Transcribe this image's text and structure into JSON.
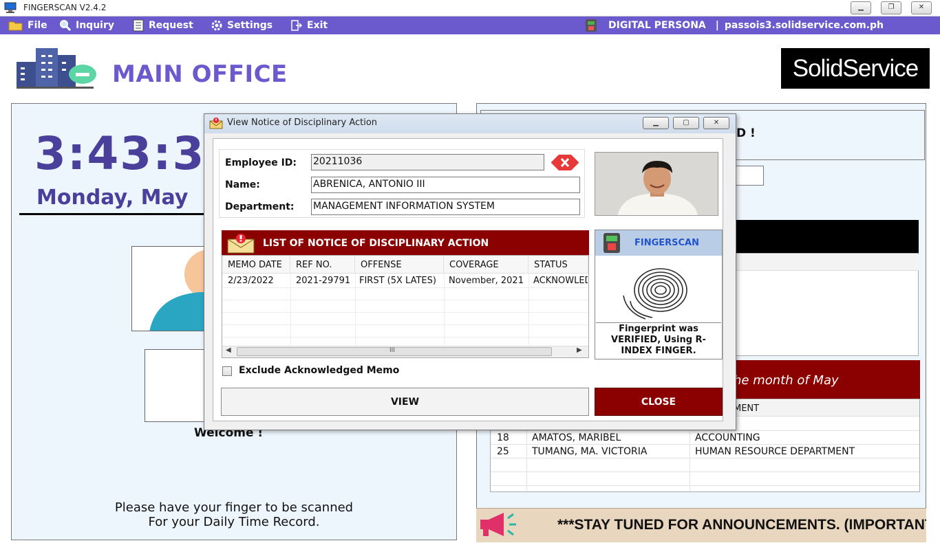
{
  "window": {
    "title": "FINGERSCAN V2.4.2"
  },
  "menu": {
    "file": "File",
    "inquiry": "Inquiry",
    "request": "Request",
    "settings": "Settings",
    "exit": "Exit",
    "device": "DIGITAL PERSONA",
    "server": "passois3.solidservice.com.ph",
    "separator": "|"
  },
  "header": {
    "office": "MAIN OFFICE",
    "logo": "SolidService"
  },
  "left": {
    "clock": "3:43:3",
    "date": "Monday, May",
    "welcome": "Welcome !",
    "instruction_1": "Please have your finger to be scanned",
    "instruction_2": "For your Daily Time Record."
  },
  "right": {
    "top_text": "D !",
    "birthday_title": "he month of May",
    "birthday_dept_header": "MENT",
    "birthdays": [
      {
        "day": "18",
        "name": "AMATOS, MARIBEL",
        "dept": "ACCOUNTING"
      },
      {
        "day": "25",
        "name": "TUMANG, MA. VICTORIA",
        "dept": "HUMAN RESOURCE DEPARTMENT"
      }
    ],
    "announcement": "***STAY TUNED FOR ANNOUNCEMENTS. (IMPORTANT"
  },
  "dialog": {
    "title": "View Notice of Disciplinary Action",
    "employee_id_label": "Employee ID:",
    "employee_id": "20211036",
    "name_label": "Name:",
    "name": "ABRENICA, ANTONIO III",
    "department_label": "Department:",
    "department": "MANAGEMENT INFORMATION SYSTEM",
    "list_title": "LIST OF NOTICE OF DISCIPLINARY ACTION",
    "columns": [
      "MEMO DATE",
      "REF NO.",
      "OFFENSE",
      "COVERAGE",
      "STATUS"
    ],
    "rows": [
      {
        "memo_date": "2/23/2022",
        "ref_no": "2021-29791",
        "offense": "FIRST (5X LATES)",
        "coverage": "November, 2021",
        "status": "ACKNOWLEDGED"
      }
    ],
    "scroll_grip": "III",
    "fingerscan_title": "FINGERSCAN",
    "fingerprint_status": "Fingerprint was VERIFIED, Using R-INDEX FINGER.",
    "exclude_label": "Exclude Acknowledged Memo",
    "view_button": "VIEW",
    "close_button": "CLOSE"
  },
  "colors": {
    "menubar": "#6a5acd",
    "accent_red": "#8b0000",
    "clock": "#4a3f9a"
  }
}
